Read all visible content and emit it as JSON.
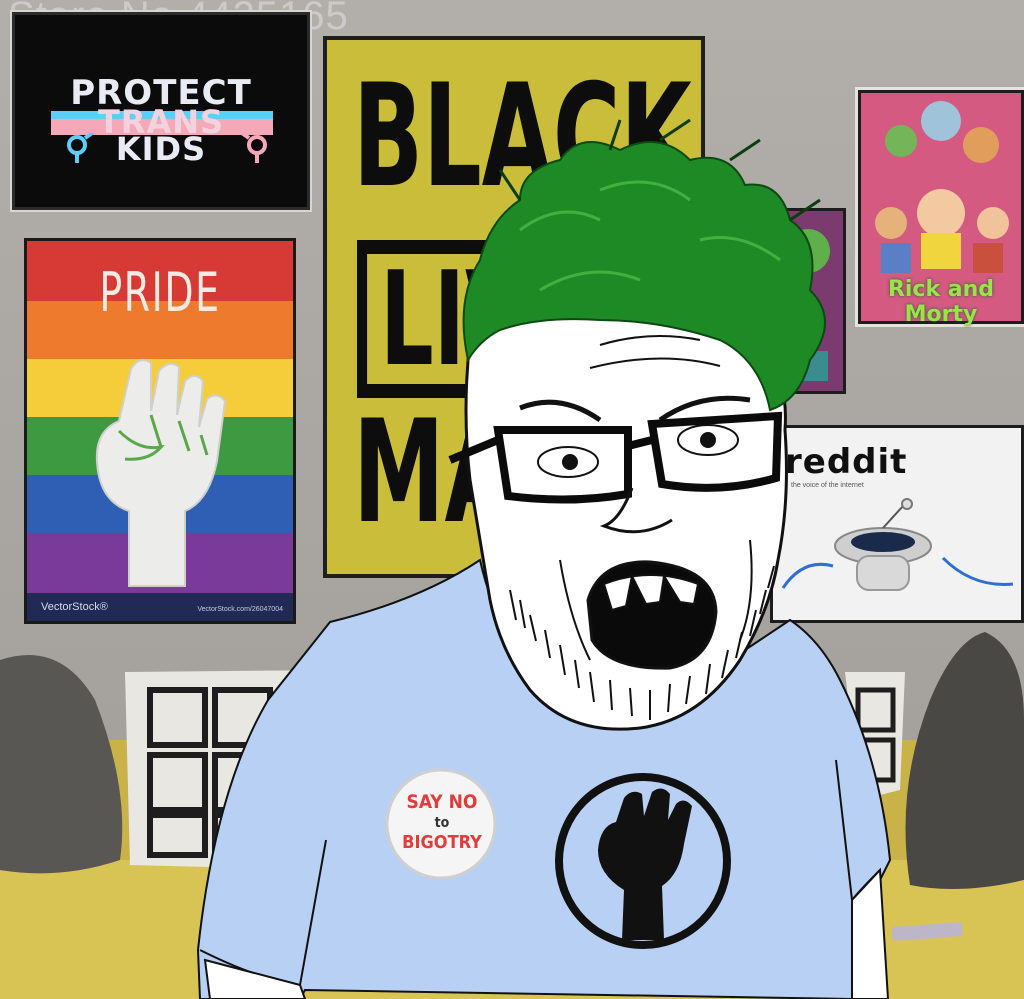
{
  "watermark": "Stare No 4425165",
  "posters": {
    "protect_trans_kids": {
      "line1": "PROTECT",
      "line2": "TRANS",
      "line3": "KIDS"
    },
    "pride": {
      "title": "PRIDE",
      "brand": "VectorStock®",
      "url": "VectorStock.com/26047004"
    },
    "blm": {
      "word1": "BLACK",
      "word2": "LIV",
      "word3": "MA"
    },
    "rick_and_morty": {
      "logo": "Rick and Morty"
    },
    "reddit": {
      "word": "reddit",
      "tagline": "the voice of the internet"
    }
  },
  "badge": {
    "line1": "SAY NO",
    "line2": "to",
    "line3": "BIGOTRY"
  },
  "colors": {
    "wall": "#a9a6a2",
    "sofa": "#d8c454",
    "shirt": "#b9d0f5",
    "hair": "#1e8a26",
    "blm_yellow": "#c9bd3a",
    "pride_stripes": [
      "#d73a34",
      "#ee7a2e",
      "#f5cd3a",
      "#3d9a40",
      "#2f5fb4",
      "#7a3a9a"
    ],
    "trans_stripes": [
      "#5bcefa",
      "#f5a9b8",
      "#ffffff",
      "#f5a9b8",
      "#5bcefa"
    ]
  },
  "icons": [
    "raised-fist-icon",
    "raised-fist-emblem-icon",
    "reddit-alien-icon",
    "trans-symbol-icon"
  ]
}
